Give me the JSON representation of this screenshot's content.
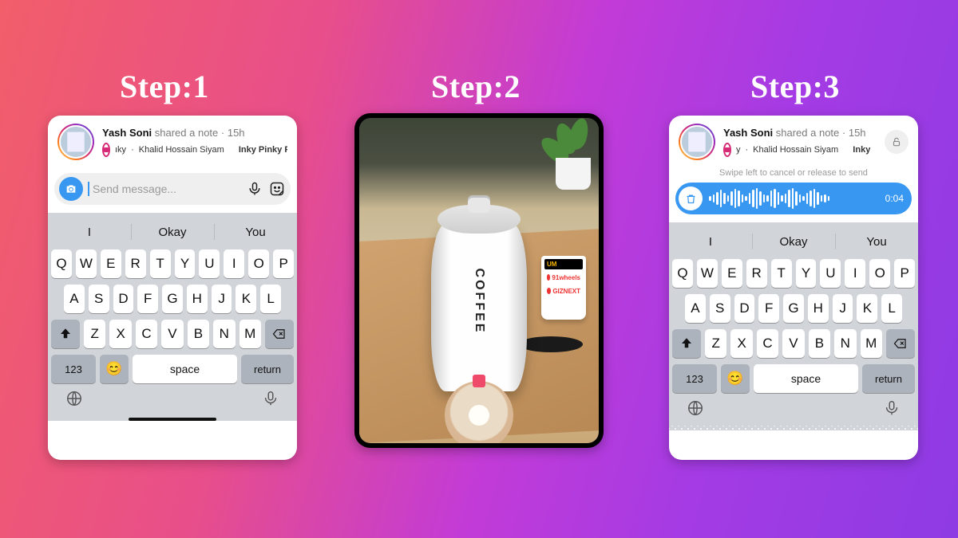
{
  "steps": {
    "s1": "Step:1",
    "s2": "Step:2",
    "s3": "Step:3"
  },
  "note": {
    "username": "Yash Soni",
    "action": "shared a note",
    "time": "15h",
    "sep": " · ",
    "line2_pre_1": "ıky",
    "line2_pre_3": "y",
    "line2_artist": "Khalid Hossain Siyam",
    "line2_song_1": "Inky Pinky P",
    "line2_song_3": "Inky Pinky Pe"
  },
  "input": {
    "placeholder": "Send message..."
  },
  "voice": {
    "hint": "Swipe left to cancel or release to send",
    "time": "0:04"
  },
  "camera": {
    "mug_text": "COFFEE",
    "logo1": "UM",
    "logo2": "91wheels",
    "logo3": "GIZNEXT"
  },
  "keyboard": {
    "suggestions": [
      "I",
      "Okay",
      "You"
    ],
    "row1": [
      "Q",
      "W",
      "E",
      "R",
      "T",
      "Y",
      "U",
      "I",
      "O",
      "P"
    ],
    "row2": [
      "A",
      "S",
      "D",
      "F",
      "G",
      "H",
      "J",
      "K",
      "L"
    ],
    "row3": [
      "Z",
      "X",
      "C",
      "V",
      "B",
      "N",
      "M"
    ],
    "num": "123",
    "space": "space",
    "ret": "return"
  }
}
